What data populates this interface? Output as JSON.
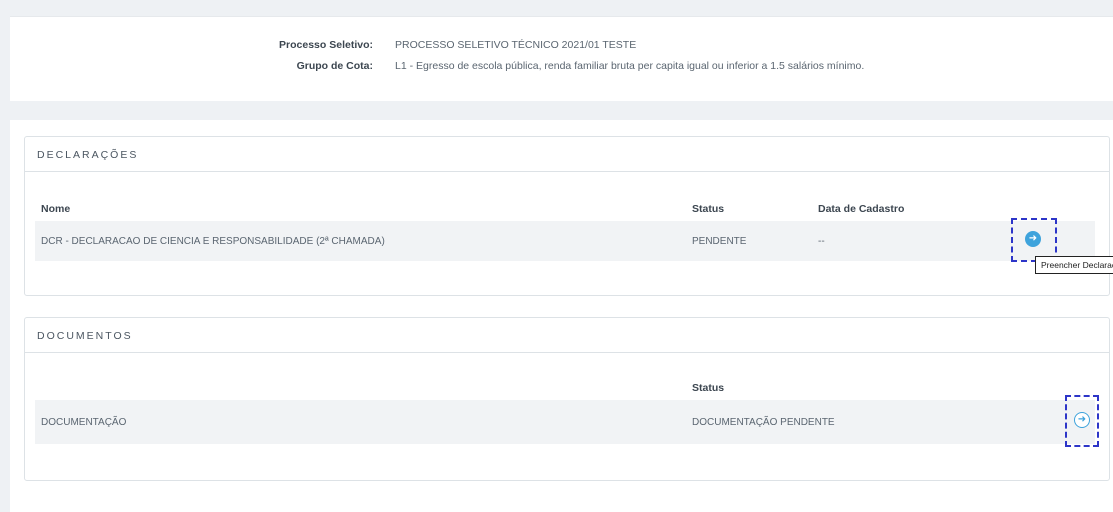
{
  "info": {
    "processo_label": "Processo Seletivo:",
    "processo_value": "PROCESSO SELETIVO TÉCNICO 2021/01 TESTE",
    "cota_label": "Grupo de Cota:",
    "cota_value": "L1 - Egresso de escola pública, renda familiar bruta per capita igual ou inferior a 1.5 salários mínimo."
  },
  "declaracoes": {
    "title": "DECLARAÇÕES",
    "columns": {
      "nome": "Nome",
      "status": "Status",
      "data": "Data de Cadastro"
    },
    "rows": [
      {
        "nome": "DCR - DECLARACAO DE CIENCIA E RESPONSABILIDADE (2ª CHAMADA)",
        "status": "PENDENTE",
        "data": "--",
        "action_icon": "arrow-right-circle-icon"
      }
    ],
    "tooltip": "Preencher Declaração"
  },
  "documentos": {
    "title": "DOCUMENTOS",
    "columns": {
      "status": "Status"
    },
    "rows": [
      {
        "nome": "DOCUMENTAÇÃO",
        "status": "DOCUMENTAÇÃO PENDENTE",
        "action_icon": "arrow-right-circle-icon"
      }
    ]
  },
  "colors": {
    "accent": "#3ea3dc",
    "highlight_dashes": "#2d35c8"
  }
}
